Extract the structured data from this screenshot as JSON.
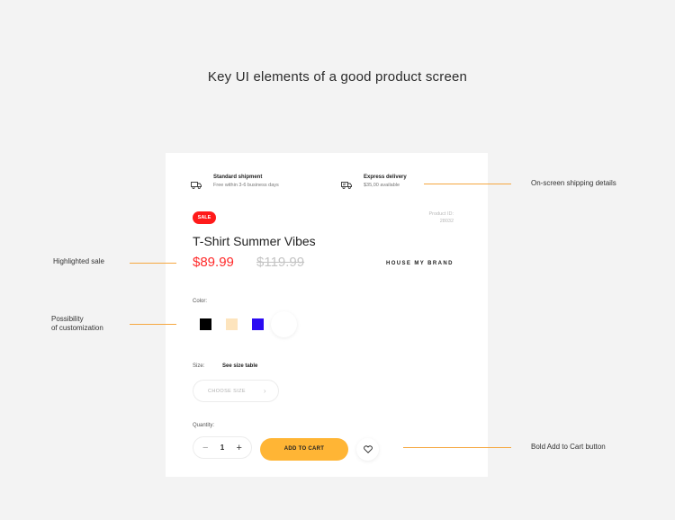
{
  "page_heading": "Key UI elements of a good product screen",
  "shipping": {
    "standard": {
      "title": "Standard shipment",
      "subtitle": "Free within 3-6 business days",
      "icon": "truck-icon"
    },
    "express": {
      "title": "Express delivery",
      "subtitle": "$35,00 available",
      "icon": "fast-truck-icon"
    }
  },
  "product": {
    "badge": "SALE",
    "id_label": "Product ID:",
    "id_value": "28032",
    "title": "T-Shirt Summer Vibes",
    "price_new": "$89.99",
    "price_old": "$119.99",
    "brand": "HOUSE MY BRAND"
  },
  "color": {
    "label": "Color:",
    "swatches": [
      "#000000",
      "#fde4bd",
      "#2b0bf2",
      "#ffffff"
    ],
    "selected_index": 3
  },
  "size": {
    "label": "Size:",
    "table_link": "See size table",
    "placeholder": "CHOOSE SIZE"
  },
  "quantity": {
    "label": "Quantity:",
    "value": "1",
    "minus": "−",
    "plus": "+"
  },
  "actions": {
    "add_to_cart": "ADD TO CART",
    "wishlist_icon": "heart-icon"
  },
  "annotations": {
    "shipping": "On-screen shipping details",
    "sale": "Highlighted sale",
    "customization_line1": "Possibility",
    "customization_line2": "of customization",
    "cart": "Bold Add to Cart button"
  },
  "colors": {
    "background": "#f3f3f3",
    "card": "#ffffff",
    "sale_red": "#ff2a2a",
    "cart_accent": "#ffb535",
    "annotation_line": "#f5a740"
  }
}
